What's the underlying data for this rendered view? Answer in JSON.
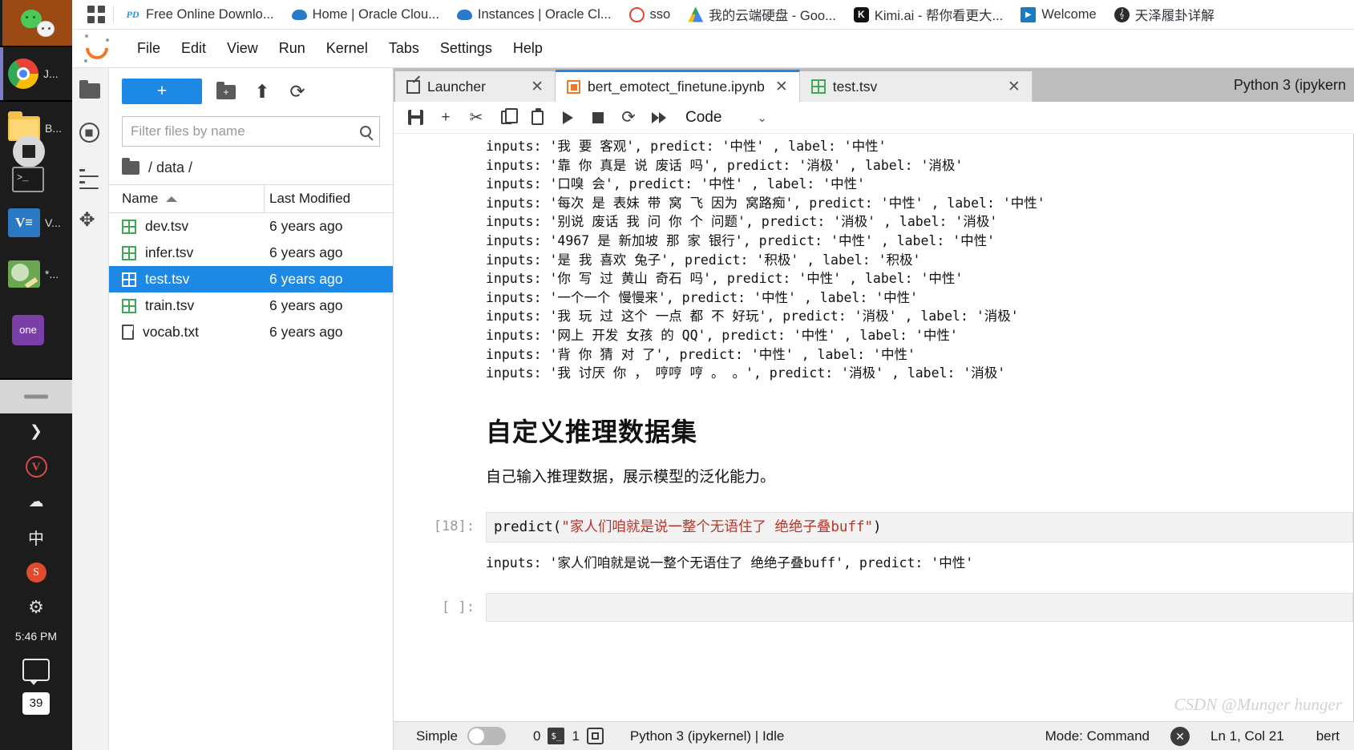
{
  "taskbar": {
    "apps": [
      {
        "name": "wechat",
        "label": ""
      },
      {
        "name": "chrome",
        "label": "J..."
      },
      {
        "name": "folder",
        "label": "B..."
      },
      {
        "name": "stopdisk",
        "label": ""
      },
      {
        "name": "terminal",
        "label": ""
      },
      {
        "name": "vscode",
        "label": "V...",
        "glyph": "V≡"
      },
      {
        "name": "paint",
        "label": "*..."
      },
      {
        "name": "onenote",
        "label": "",
        "glyph": "one"
      }
    ],
    "tray": {
      "chevron": "❯",
      "v_glyph": "V",
      "cloud_glyph": "☁",
      "ime_label": "中",
      "sogou_glyph": "S",
      "gear_glyph": "⚙",
      "time": "5:46 PM",
      "notification_count": "39"
    }
  },
  "browser": {
    "apps_button_label": "apps-grid",
    "tabs": [
      {
        "title": "Free Online Downlo...",
        "favicon": "pd-icon",
        "glyph": "PD"
      },
      {
        "title": "Home | Oracle Clou...",
        "favicon": "cloud-icon",
        "glyph": ""
      },
      {
        "title": "Instances | Oracle Cl...",
        "favicon": "cloud-icon",
        "glyph": ""
      },
      {
        "title": "sso",
        "favicon": "ring-icon",
        "glyph": ""
      },
      {
        "title": "我的云端硬盘 - Goo...",
        "favicon": "drive-icon",
        "glyph": ""
      },
      {
        "title": "Kimi.ai - 帮你看更大...",
        "favicon": "kimi-icon",
        "glyph": "K"
      },
      {
        "title": "Welcome",
        "favicon": "play-icon",
        "glyph": "▶"
      },
      {
        "title": "天泽履卦详解",
        "favicon": "wave-icon",
        "glyph": "𝄞"
      }
    ]
  },
  "jupyter": {
    "menu": [
      "File",
      "Edit",
      "View",
      "Run",
      "Kernel",
      "Tabs",
      "Settings",
      "Help"
    ],
    "activity_bar": [
      {
        "name": "file-browser-icon"
      },
      {
        "name": "running-terminals-icon"
      },
      {
        "name": "table-of-contents-icon"
      },
      {
        "name": "extension-manager-icon",
        "glyph": "✥"
      }
    ],
    "file_browser": {
      "new_button_label": "+",
      "new_folder_icon": "new-folder-icon",
      "upload_icon": "⬆",
      "refresh_icon": "⟳",
      "filter_placeholder": "Filter files by name",
      "filter_value": "",
      "breadcrumb": "/ data /",
      "columns": [
        "Name",
        "Last Modified"
      ],
      "sort_caret": "ascending",
      "files": [
        {
          "name": "dev.tsv",
          "modified": "6 years ago",
          "icon": "tsv-icon",
          "selected": false
        },
        {
          "name": "infer.tsv",
          "modified": "6 years ago",
          "icon": "tsv-icon",
          "selected": false
        },
        {
          "name": "test.tsv",
          "modified": "6 years ago",
          "icon": "tsv-icon",
          "selected": true
        },
        {
          "name": "train.tsv",
          "modified": "6 years ago",
          "icon": "tsv-icon",
          "selected": false
        },
        {
          "name": "vocab.txt",
          "modified": "6 years ago",
          "icon": "txt-icon",
          "selected": false
        }
      ]
    },
    "dock_tabs": [
      {
        "label": "Launcher",
        "icon": "launcher-icon",
        "active": false,
        "close": "✕"
      },
      {
        "label": "bert_emotect_finetune.ipynb",
        "icon": "notebook-icon",
        "active": true,
        "close": "✕"
      },
      {
        "label": "test.tsv",
        "icon": "tsv-icon",
        "active": false,
        "close": "✕"
      }
    ],
    "kernel_display": "Python 3 (ipykern",
    "toolbar": {
      "save": "save-icon",
      "insert": "+",
      "cut": "✂",
      "copy": "copy-icon",
      "paste": "paste-icon",
      "run": "run-icon",
      "stop": "stop-icon",
      "restart": "⟳",
      "restart_run_all": "fast-forward-icon",
      "cell_type": "Code",
      "chevron": "⌄"
    },
    "notebook": {
      "output_lines": [
        "inputs: '我 要 客观', predict: '中性' , label: '中性'",
        "inputs: '靠 你 真是 说 废话 吗', predict: '消极' , label: '消极'",
        "inputs: '口嗅 会', predict: '中性' , label: '中性'",
        "inputs: '每次 是 表妹 带 窝 飞 因为 窝路痴', predict: '中性' , label: '中性'",
        "inputs: '别说 废话 我 问 你 个 问题', predict: '消极' , label: '消极'",
        "inputs: '4967 是 新加坡 那 家 银行', predict: '中性' , label: '中性'",
        "inputs: '是 我 喜欢 兔子', predict: '积极' , label: '积极'",
        "inputs: '你 写 过 黄山 奇石 吗', predict: '中性' , label: '中性'",
        "inputs: '一个一个 慢慢来', predict: '中性' , label: '中性'",
        "inputs: '我 玩 过 这个 一点 都 不 好玩', predict: '消极' , label: '消极'",
        "inputs: '网上 开发 女孩 的 QQ', predict: '中性' , label: '中性'",
        "inputs: '背 你 猜 对 了', predict: '中性' , label: '中性'",
        "inputs: '我 讨厌 你 ， 哼哼 哼 。 。', predict: '消极' , label: '消极'"
      ],
      "markdown_heading": "自定义推理数据集",
      "markdown_paragraph": "自己输入推理数据，展示模型的泛化能力。",
      "code_cell": {
        "prompt": "[18]:",
        "code_prefix": "predict(",
        "code_string": "\"家人们咱就是说一整个无语住了 绝绝子叠buff\"",
        "code_suffix": ")"
      },
      "code_output": "inputs: '家人们咱就是说一整个无语住了 绝绝子叠buff', predict: '中性'",
      "empty_cell_prompt": "[ ]:",
      "empty_cell_code": ""
    },
    "status_bar": {
      "simple_label": "Simple",
      "simple_on": false,
      "terminals_count": "0",
      "terminal_icon": "$_",
      "kernels_count": "1",
      "cpu_icon": "cpu-icon",
      "kernel_status": "Python 3 (ipykernel) | Idle",
      "mode": "Mode: Command",
      "unsaved_icon": "no-save-icon",
      "cursor_position": "Ln 1, Col 21",
      "branch": "bert"
    }
  },
  "watermark": "CSDN @Munger hunger",
  "colors": {
    "accent_blue": "#1e88e5",
    "jupyter_orange": "#f37726",
    "tsv_green": "#3eaa54",
    "string_red": "#b5372b",
    "taskbar_dark": "#1c1c1c",
    "wechat_brown": "#9c4a14"
  }
}
